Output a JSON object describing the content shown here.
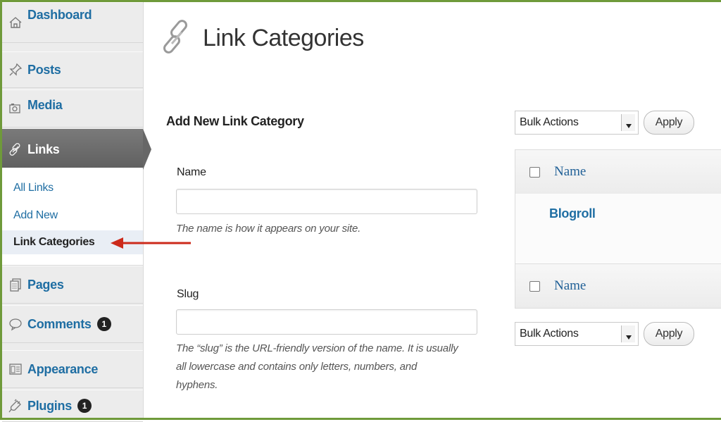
{
  "colors": {
    "frame": "#6f9a3a",
    "link": "#1f6ea3",
    "active_menu": "#676767",
    "annotation_arrow": "#cc2a1b"
  },
  "sidebar": {
    "items": [
      {
        "label": "Dashboard",
        "icon": "home-icon"
      },
      {
        "label": "Posts",
        "icon": "pushpin-icon"
      },
      {
        "label": "Media",
        "icon": "media-icon"
      },
      {
        "label": "Links",
        "icon": "link-icon",
        "active": true
      },
      {
        "label": "Pages",
        "icon": "pages-icon"
      },
      {
        "label": "Comments",
        "icon": "comment-bubble-icon",
        "badge": "1"
      },
      {
        "label": "Appearance",
        "icon": "appearance-icon"
      },
      {
        "label": "Plugins",
        "icon": "plugin-icon",
        "badge": "1"
      }
    ],
    "submenu": [
      {
        "label": "All Links"
      },
      {
        "label": "Add New"
      },
      {
        "label": "Link Categories",
        "current": true
      }
    ]
  },
  "page": {
    "title": "Link Categories",
    "title_icon": "link-icon"
  },
  "form": {
    "heading": "Add New Link Category",
    "name_label": "Name",
    "name_value": "",
    "name_hint": "The name is how it appears on your site.",
    "slug_label": "Slug",
    "slug_value": "",
    "slug_hint_line1": "The “slug” is the URL-friendly version of the name. It is usually",
    "slug_hint_line2": "all lowercase and contains only letters, numbers, and",
    "slug_hint_line3": "hyphens."
  },
  "list": {
    "bulk_actions_top": "Bulk Actions",
    "apply_top": "Apply",
    "column_name": "Name",
    "rows": [
      {
        "name": "Blogroll"
      }
    ],
    "bulk_actions_bottom": "Bulk Actions",
    "apply_bottom": "Apply"
  }
}
